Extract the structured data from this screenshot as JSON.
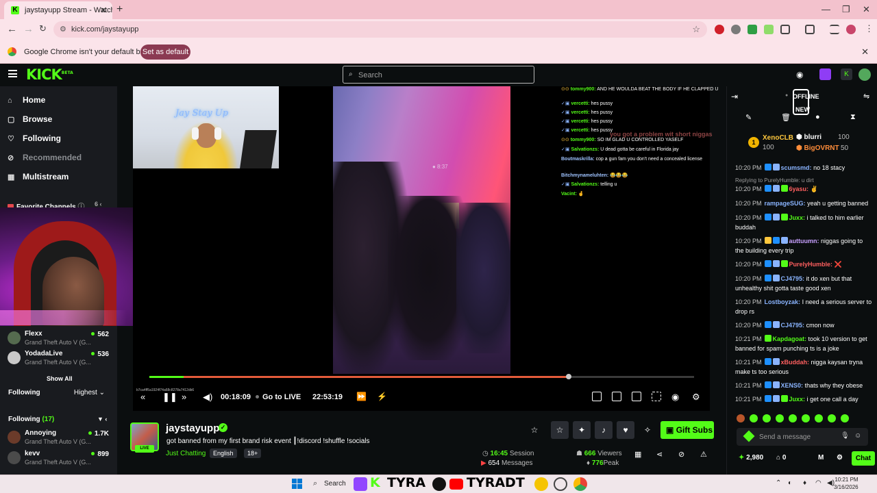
{
  "browser": {
    "tab_title": "jaystayupp Stream - Watch",
    "url": "kick.com/jaystayupp",
    "info_message": "Google Chrome isn't your default browser",
    "info_button": "Set as default"
  },
  "kick": {
    "logo": "KICK",
    "logo_sup": "BETA",
    "search_placeholder": "Search"
  },
  "sidebar": {
    "nav": [
      {
        "label": "Home",
        "icon": "home-icon"
      },
      {
        "label": "Browse",
        "icon": "browse-icon"
      },
      {
        "label": "Following",
        "icon": "heart-icon"
      },
      {
        "label": "Recommended",
        "icon": "eye-off-icon"
      },
      {
        "label": "Multistream",
        "icon": "grid-icon"
      }
    ],
    "favorites_title": "Favorite Channels",
    "favorites_count": "6",
    "favorites": [
      {
        "name": "Flexx",
        "game": "Grand Theft Auto V (G...",
        "viewers": "562"
      },
      {
        "name": "YodadaLive",
        "game": "Grand Theft Auto V (G...",
        "viewers": "536"
      }
    ],
    "show_all": "Show All",
    "following_label": "Following",
    "sort_label": "Highest",
    "following_section": "Following",
    "following_count": "(17)",
    "following_list": [
      {
        "name": "Annoying",
        "game": "Grand Theft Auto V (G...",
        "viewers": "1.7K"
      },
      {
        "name": "kevv",
        "game": "Grand Theft Auto V (G...",
        "viewers": "899"
      }
    ]
  },
  "stream": {
    "cam_neon": "Jay Stay Up",
    "video_watermark": "● 8:37",
    "overlay_chat": [
      {
        "name": "tommy900:",
        "text": "AND HE WOULDA BEAT THE BODY IF HE CLAPPED U",
        "color": "#53fc18"
      },
      {
        "name": "vercetti:",
        "text": "hes pussy",
        "color": "#53fc18"
      },
      {
        "name": "vercetti:",
        "text": "hes pussy",
        "color": "#53fc18"
      },
      {
        "name": "vercetti:",
        "text": "hes pussy",
        "color": "#53fc18"
      },
      {
        "name": "vercetti:",
        "text": "hes pussy",
        "color": "#53fc18"
      },
      {
        "name": "tommy900:",
        "text": "SO IM GLAD U CONTROLLED YASELF",
        "color": "#53fc18"
      },
      {
        "name": "Salvationzs:",
        "text": "U dead gotta be careful in Florida jay",
        "color": "#53fc18"
      },
      {
        "name": "Boutmaskrilla:",
        "text": "cop a gun fam you don't need a concealed license",
        "color": "#9fc3ff"
      },
      {
        "name": "Bitchmynameluhten:",
        "text": "😂😂😂",
        "color": "#9fc3ff"
      },
      {
        "name": "Salvationzs:",
        "text": "telling u",
        "color": "#53fc18"
      },
      {
        "name": "Vacint:",
        "text": "🤞",
        "color": "#53fc18"
      }
    ],
    "overlay_red": "you got a problem wit short niggas",
    "hash": "b7ca4ff5a1924f74a68c8278a7412db6",
    "elapsed": "00:18:09",
    "go_live": "Go to LIVE",
    "clock": "22:53:19",
    "progress_fraction": 0.77
  },
  "channel": {
    "name": "jaystayupp",
    "live": "LIVE",
    "title": "got banned from my first brand risk event  ┃!discord !shuffle !socials",
    "category": "Just Chatting",
    "tags": [
      "English",
      "18+"
    ],
    "gift_button": "Gift Subs",
    "session_value": "16:45",
    "session_label": "Session",
    "messages_value": "654",
    "messages_label": "Messages",
    "viewers_value": "666",
    "viewers_label": "Viewers",
    "peak_value": "776",
    "peak_label": "Peak"
  },
  "chat": {
    "offline": "OFFLINE",
    "new": "NEW",
    "leaders": [
      {
        "name": "XenoCLB",
        "pts": "100"
      },
      {
        "name": "blurri",
        "pts": "100"
      },
      {
        "name": "BigOVRNT",
        "pts": "50"
      }
    ],
    "reply_to": "Replying to PurelyHumble: u dirt",
    "messages": [
      {
        "time": "10:20 PM",
        "name": "scumsmd:",
        "color": "#8ab4ff",
        "text": "no 18 stacy"
      },
      {
        "time": "10:20 PM",
        "name": "6yasu:",
        "color": "#ff5f5f",
        "text": "✌️"
      },
      {
        "time": "10:20 PM",
        "name": "rampageSUG:",
        "color": "#8ab4ff",
        "text": "yeah u getting banned"
      },
      {
        "time": "10:20 PM",
        "name": "Juxx:",
        "color": "#53fc18",
        "text": "i talked to him earlier buddah"
      },
      {
        "time": "10:20 PM",
        "name": "auttuumn:",
        "color": "#c8a0ff",
        "text": "niggas going to the building every trip"
      },
      {
        "time": "10:20 PM",
        "name": "PurelyHumble:",
        "color": "#ff5f5f",
        "text": "❌"
      },
      {
        "time": "10:20 PM",
        "name": "CJ4795:",
        "color": "#8ab4ff",
        "text": "it do xen but that unhealthy shit gotta taste good xen"
      },
      {
        "time": "10:20 PM",
        "name": "Lostboyzak:",
        "color": "#8ab4ff",
        "text": "I need a serious server to drop rs"
      },
      {
        "time": "10:20 PM",
        "name": "CJ4795:",
        "color": "#8ab4ff",
        "text": "cmon now"
      },
      {
        "time": "10:21 PM",
        "name": "Kapdagoat:",
        "color": "#53fc18",
        "text": "took 10 version to get banned for spam punching ts is a joke"
      },
      {
        "time": "10:21 PM",
        "name": "xBuddah:",
        "color": "#ff5f5f",
        "text": "nigga kaysan tryna make ts too serious"
      },
      {
        "time": "10:21 PM",
        "name": "XENS0:",
        "color": "#8ab4ff",
        "text": "thats why they obese"
      },
      {
        "time": "10:21 PM",
        "name": "Juxx:",
        "color": "#53fc18",
        "text": "i get one call a day"
      }
    ],
    "send_placeholder": "Send a message",
    "points": "2,980",
    "zero": "0",
    "chat_button": "Chat"
  },
  "taskbar": {
    "search": "Search",
    "word1": "TYRA",
    "word2": "TYRADT",
    "time": "10:21 PM",
    "date": "3/16/2026"
  },
  "colors": {
    "accent": "#53fc18",
    "chrome_pink": "#f3c2cd"
  }
}
